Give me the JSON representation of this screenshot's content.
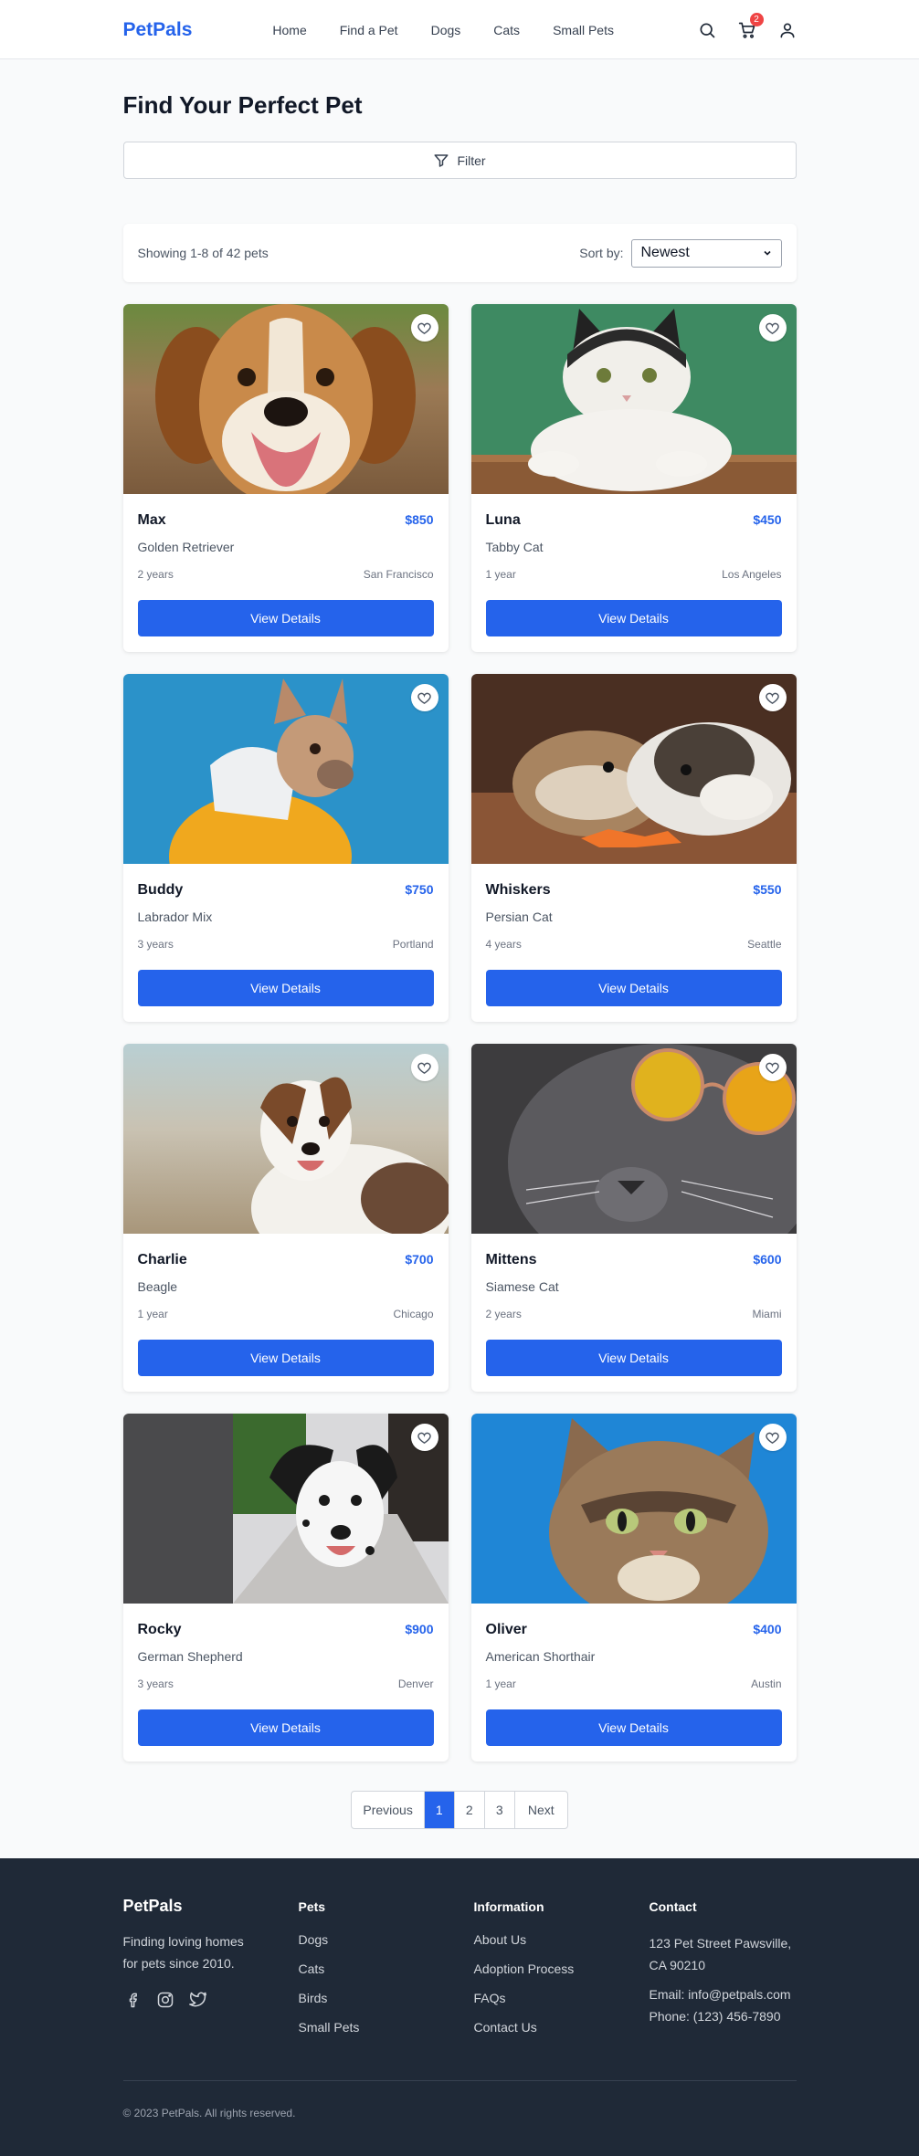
{
  "header": {
    "logo": "PetPals",
    "nav": [
      "Home",
      "Find a Pet",
      "Dogs",
      "Cats",
      "Small Pets"
    ],
    "cart_count": "2"
  },
  "page": {
    "title": "Find Your Perfect Pet",
    "filter_label": "Filter",
    "showing": "Showing 1-8 of 42 pets",
    "sort_label": "Sort by:",
    "sort_value": "Newest"
  },
  "pets": [
    {
      "name": "Max",
      "price": "$850",
      "breed": "Golden Retriever",
      "age": "2 years",
      "location": "San Francisco",
      "button": "View Details"
    },
    {
      "name": "Luna",
      "price": "$450",
      "breed": "Tabby Cat",
      "age": "1 year",
      "location": "Los Angeles",
      "button": "View Details"
    },
    {
      "name": "Buddy",
      "price": "$750",
      "breed": "Labrador Mix",
      "age": "3 years",
      "location": "Portland",
      "button": "View Details"
    },
    {
      "name": "Whiskers",
      "price": "$550",
      "breed": "Persian Cat",
      "age": "4 years",
      "location": "Seattle",
      "button": "View Details"
    },
    {
      "name": "Charlie",
      "price": "$700",
      "breed": "Beagle",
      "age": "1 year",
      "location": "Chicago",
      "button": "View Details"
    },
    {
      "name": "Mittens",
      "price": "$600",
      "breed": "Siamese Cat",
      "age": "2 years",
      "location": "Miami",
      "button": "View Details"
    },
    {
      "name": "Rocky",
      "price": "$900",
      "breed": "German Shepherd",
      "age": "3 years",
      "location": "Denver",
      "button": "View Details"
    },
    {
      "name": "Oliver",
      "price": "$400",
      "breed": "American Shorthair",
      "age": "1 year",
      "location": "Austin",
      "button": "View Details"
    }
  ],
  "pagination": {
    "previous": "Previous",
    "pages": [
      "1",
      "2",
      "3"
    ],
    "next": "Next",
    "active": "1"
  },
  "footer": {
    "brand": "PetPals",
    "tagline": "Finding loving homes for pets since 2010.",
    "pets_heading": "Pets",
    "pets_links": [
      "Dogs",
      "Cats",
      "Birds",
      "Small Pets"
    ],
    "info_heading": "Information",
    "info_links": [
      "About Us",
      "Adoption Process",
      "FAQs",
      "Contact Us"
    ],
    "contact_heading": "Contact",
    "address": "123 Pet Street Pawsville, CA 90210",
    "email": "Email: info@petpals.com",
    "phone": "Phone: (123) 456-7890",
    "copyright": "© 2023 PetPals. All rights reserved."
  },
  "colors": {
    "primary": "#2563eb",
    "footer_bg": "#1f2937",
    "badge": "#ef4444"
  }
}
